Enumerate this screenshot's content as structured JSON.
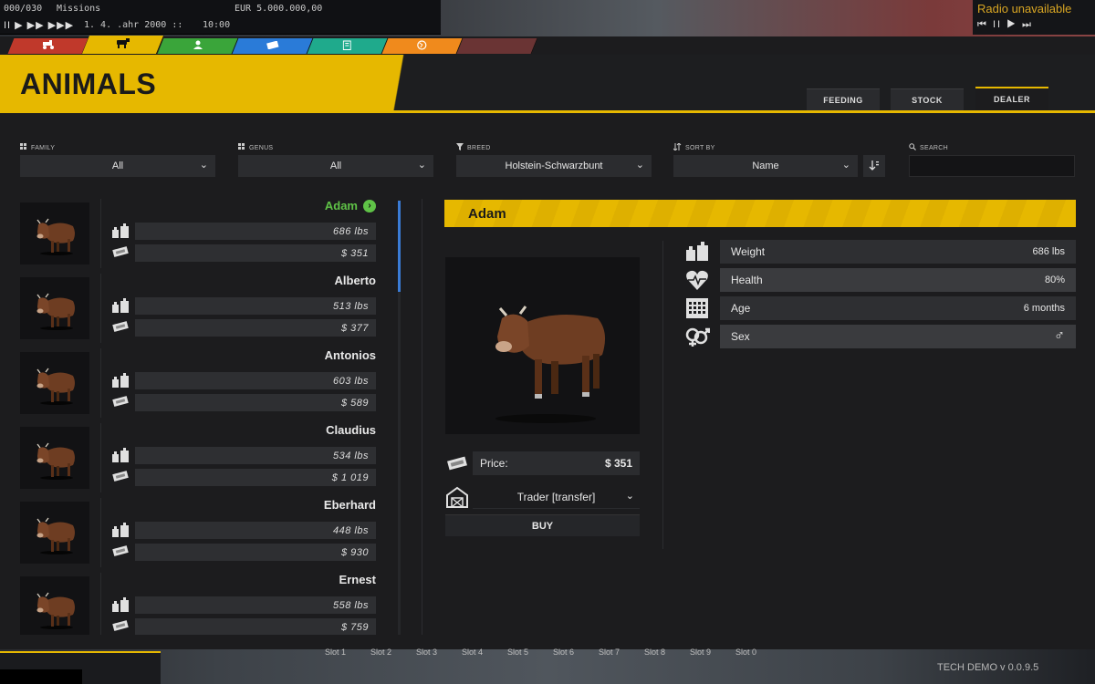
{
  "hud": {
    "counter": "000/030",
    "missions": "Missions",
    "money": "EUR 5.000.000,00",
    "date": "1. 4.  .ahr 2000 ::",
    "time": "10:00",
    "controls": "II ▶ ▶▶ ▶▶▶",
    "radio": "Radio unavailable",
    "radio_controls": "⏮ II ▶ ⏭"
  },
  "category_tabs": [
    {
      "icon": "tractor-icon",
      "color": "#c0392b"
    },
    {
      "icon": "cow-icon",
      "color": "#e6b800"
    },
    {
      "icon": "person-icon",
      "color": "#3aa53a"
    },
    {
      "icon": "money-icon",
      "color": "#2a7bd8"
    },
    {
      "icon": "clipboard-icon",
      "color": "#1faa8c"
    },
    {
      "icon": "globe-icon",
      "color": "#f08a1c"
    },
    {
      "icon": "blank-icon",
      "color": "#7a3a3a"
    }
  ],
  "page": {
    "title": "ANIMALS"
  },
  "view_tabs": [
    {
      "label": "FEEDING"
    },
    {
      "label": "STOCK"
    },
    {
      "label": "DEALER"
    }
  ],
  "filters": {
    "family": {
      "label": "FAMILY",
      "value": "All"
    },
    "genus": {
      "label": "GENUS",
      "value": "All"
    },
    "breed": {
      "label": "BREED",
      "value": "Holstein-Schwarzbunt"
    },
    "sort": {
      "label": "SORT BY",
      "value": "Name"
    },
    "search": {
      "label": "SEARCH",
      "value": ""
    }
  },
  "animals": [
    {
      "name": "Adam",
      "weight": "686 lbs",
      "price": "$ 351"
    },
    {
      "name": "Alberto",
      "weight": "513 lbs",
      "price": "$ 377"
    },
    {
      "name": "Antonios",
      "weight": "603 lbs",
      "price": "$ 589"
    },
    {
      "name": "Claudius",
      "weight": "534 lbs",
      "price": "$ 1 019"
    },
    {
      "name": "Eberhard",
      "weight": "448 lbs",
      "price": "$ 930"
    },
    {
      "name": "Ernest",
      "weight": "558 lbs",
      "price": "$ 759"
    }
  ],
  "detail": {
    "name": "Adam",
    "price_label": "Price:",
    "price_value": "$ 351",
    "destination": "Trader [transfer]",
    "buy_label": "BUY",
    "attributes": [
      {
        "label": "Weight",
        "value": "686 lbs"
      },
      {
        "label": "Health",
        "value": "80%"
      },
      {
        "label": "Age",
        "value": "6 months"
      },
      {
        "label": "Sex",
        "value": "♂"
      }
    ]
  },
  "bottom": {
    "slots": [
      "Slot 1",
      "Slot 2",
      "Slot 3",
      "Slot 4",
      "Slot 5",
      "Slot 6",
      "Slot 7",
      "Slot 8",
      "Slot 9",
      "Slot 0"
    ],
    "version": "TECH DEMO v 0.0.9.5"
  }
}
